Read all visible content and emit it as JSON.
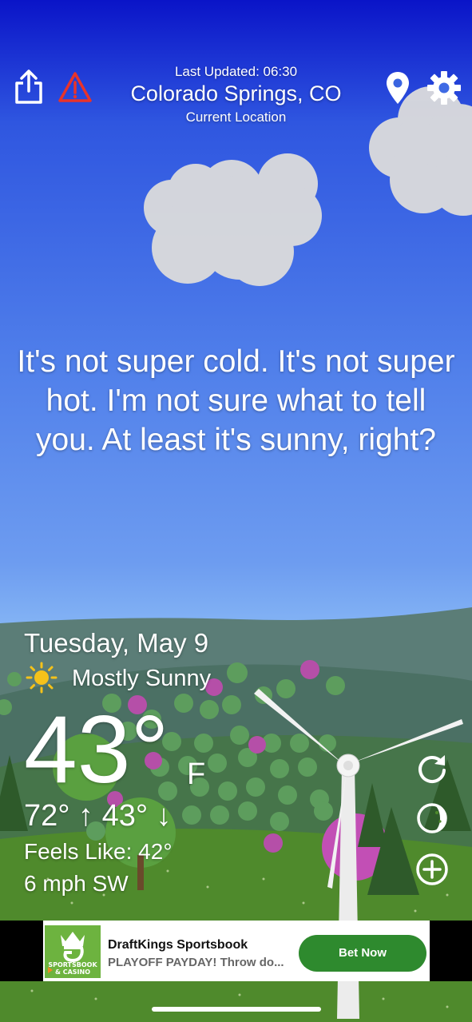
{
  "header": {
    "last_updated": "Last Updated: 06:30",
    "city": "Colorado Springs, CO",
    "location_label": "Current Location"
  },
  "icons": {
    "share": "share-icon",
    "alert": "alert-triangle-icon",
    "location": "location-pin-icon",
    "settings": "gear-icon",
    "condition": "sun-icon",
    "refresh": "refresh-icon",
    "moon": "moon-phase-icon",
    "add": "add-circle-icon"
  },
  "message": "It's not super cold. It's not super hot. I'm not sure what to tell you. At least it's sunny, right?",
  "weather": {
    "date": "Tuesday, May 9",
    "condition": "Mostly Sunny",
    "temperature": "43°",
    "unit": "F",
    "high_low": "72° ↑ 43° ↓",
    "feels_like": "Feels Like: 42°",
    "wind": "6 mph SW"
  },
  "ad": {
    "logo_text": "SPORTSBOOK & CASINO",
    "title": "DraftKings Sportsbook",
    "subtitle": "PLAYOFF PAYDAY! Throw do...",
    "cta": "Bet Now"
  },
  "colors": {
    "sky_top": "#0a14c8",
    "sky_bottom": "#9fcaf8",
    "grass": "#4f8a2c",
    "hills": "#4a7268",
    "ad_cta": "#2e8a2e",
    "alert": "#e8332a"
  }
}
